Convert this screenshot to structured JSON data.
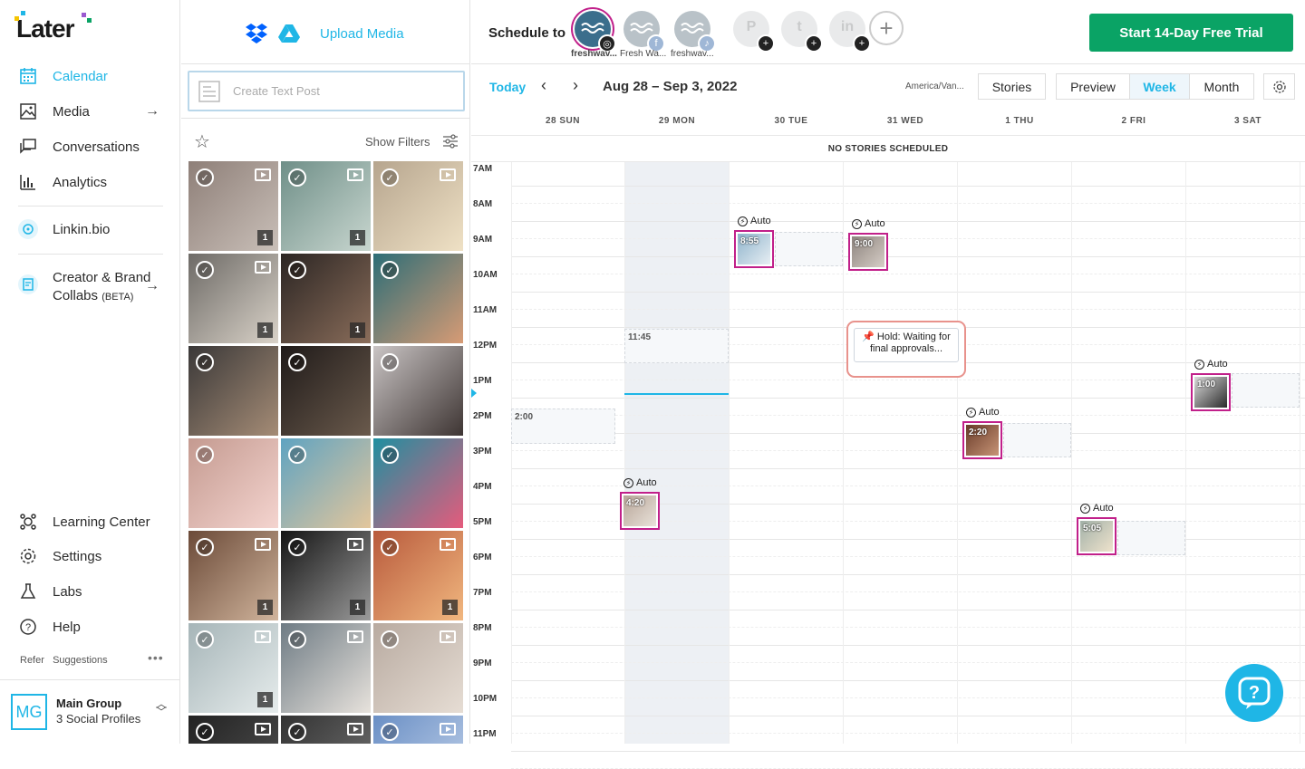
{
  "brand": {
    "name": "Later",
    "accent": "#1fb6e6",
    "trial_color": "#0aa365",
    "post_border": "#c1208a"
  },
  "nav": {
    "items": [
      {
        "label": "Calendar",
        "icon": "calendar-icon",
        "active": true
      },
      {
        "label": "Media",
        "icon": "media-icon"
      },
      {
        "label": "Conversations",
        "icon": "conversations-icon"
      },
      {
        "label": "Analytics",
        "icon": "analytics-icon"
      },
      {
        "label": "Linkin.bio",
        "icon": "linkinbio-icon"
      },
      {
        "label": "Creator & Brand",
        "label2": "Collabs",
        "beta": "(BETA)",
        "icon": "collabs-icon"
      }
    ],
    "bottom": [
      {
        "label": "Learning Center",
        "icon": "learning-center-icon"
      },
      {
        "label": "Settings",
        "icon": "settings-icon"
      },
      {
        "label": "Labs",
        "icon": "labs-icon"
      },
      {
        "label": "Help",
        "icon": "help-icon"
      }
    ],
    "refer": "Refer",
    "suggestions": "Suggestions",
    "group": {
      "initials": "MG",
      "name": "Main Group",
      "profiles": "3 Social Profiles"
    }
  },
  "media": {
    "upload": "Upload Media",
    "text_post": "Create Text Post",
    "show_filters": "Show Filters",
    "thumbs": [
      {
        "c1": "#8e7f78",
        "c2": "#c9bfb8",
        "video": true,
        "count": "1"
      },
      {
        "c1": "#6f8f88",
        "c2": "#c8d6cf",
        "video": true,
        "count": "1"
      },
      {
        "c1": "#b6a58e",
        "c2": "#efe1c5",
        "video": true,
        "count": ""
      },
      {
        "c1": "#6d6a66",
        "c2": "#d9d2c8",
        "video": true,
        "count": "1"
      },
      {
        "c1": "#2b2523",
        "c2": "#8a6d5a",
        "video": false,
        "count": "1"
      },
      {
        "c1": "#2c6d76",
        "c2": "#d79b75",
        "video": false,
        "count": ""
      },
      {
        "c1": "#3a3838",
        "c2": "#a58c76",
        "video": false,
        "count": ""
      },
      {
        "c1": "#1f1a19",
        "c2": "#6a5a4c",
        "video": false,
        "count": ""
      },
      {
        "c1": "#c9c4c4",
        "c2": "#3e3533",
        "video": false,
        "count": ""
      },
      {
        "c1": "#c49a90",
        "c2": "#f4d4cf",
        "video": false,
        "count": ""
      },
      {
        "c1": "#5fa3c1",
        "c2": "#e3c69c",
        "video": false,
        "count": ""
      },
      {
        "c1": "#1f8fa0",
        "c2": "#e55b7c",
        "video": false,
        "count": ""
      },
      {
        "c1": "#6b4a38",
        "c2": "#d0b49c",
        "video": true,
        "count": "1"
      },
      {
        "c1": "#141414",
        "c2": "#9a9a9a",
        "video": true,
        "count": "1"
      },
      {
        "c1": "#b85a3c",
        "c2": "#f1b77f",
        "video": true,
        "count": "1"
      },
      {
        "c1": "#a6b5b8",
        "c2": "#e6ecec",
        "video": true,
        "count": "1"
      },
      {
        "c1": "#6e7b84",
        "c2": "#e7e2dc",
        "video": true,
        "count": ""
      },
      {
        "c1": "#b8aaa0",
        "c2": "#e6ddd4",
        "video": true,
        "count": ""
      },
      {
        "c1": "#222",
        "c2": "#555",
        "video": true,
        "count": ""
      },
      {
        "c1": "#333",
        "c2": "#777",
        "video": true,
        "count": ""
      },
      {
        "c1": "#6a8fc5",
        "c2": "#c7d6ec",
        "video": true,
        "count": ""
      }
    ]
  },
  "top": {
    "schedule_to": "Schedule to",
    "profiles": [
      {
        "label": "freshwav...",
        "badge": "instagram-icon",
        "glyph": "◎"
      },
      {
        "label": "Fresh Wa...",
        "badge": "facebook-icon",
        "glyph": "f"
      },
      {
        "label": "freshwav...",
        "badge": "tiktok-icon",
        "glyph": "♪"
      }
    ],
    "add_profiles": [
      {
        "icon": "pinterest-icon",
        "glyph": "P"
      },
      {
        "icon": "twitter-icon",
        "glyph": "t"
      },
      {
        "icon": "linkedin-icon",
        "glyph": "in"
      }
    ],
    "trial": "Start 14-Day Free Trial"
  },
  "toolbar": {
    "today": "Today",
    "range": "Aug 28 – Sep 3, 2022",
    "timezone": "America/Van...",
    "stories": "Stories",
    "preview": "Preview",
    "week": "Week",
    "month": "Month"
  },
  "calendar": {
    "days": [
      "28 SUN",
      "29 MON",
      "30 TUE",
      "31 WED",
      "1 THU",
      "2 FRI",
      "3 SAT"
    ],
    "no_stories": "NO STORIES SCHEDULED",
    "hours": [
      "7AM",
      "8AM",
      "9AM",
      "10AM",
      "11AM",
      "12PM",
      "1PM",
      "2PM",
      "3PM",
      "4PM",
      "5PM",
      "6PM",
      "7PM",
      "8PM",
      "9PM",
      "10PM",
      "11PM"
    ],
    "slots": [
      {
        "label": "2:00"
      },
      {
        "label": "11:45"
      }
    ],
    "posts": [
      {
        "time": "8:55",
        "auto": "Auto",
        "c1": "#8fb4cc",
        "c2": "#e7eef3"
      },
      {
        "time": "9:00",
        "auto": "Auto",
        "c1": "#8d847e",
        "c2": "#d6cdc6"
      },
      {
        "time": "1:00",
        "auto": "Auto",
        "c1": "#dcdcdc",
        "c2": "#2a2a2a"
      },
      {
        "time": "2:20",
        "auto": "Auto",
        "c1": "#6a3c2a",
        "c2": "#c79476"
      },
      {
        "time": "4:20",
        "auto": "Auto",
        "c1": "#b7a598",
        "c2": "#e9e2da"
      },
      {
        "time": "5:05",
        "auto": "Auto",
        "c1": "#a2b1a8",
        "c2": "#eee2cc"
      }
    ],
    "hold": "Hold: Waiting for final approvals..."
  }
}
